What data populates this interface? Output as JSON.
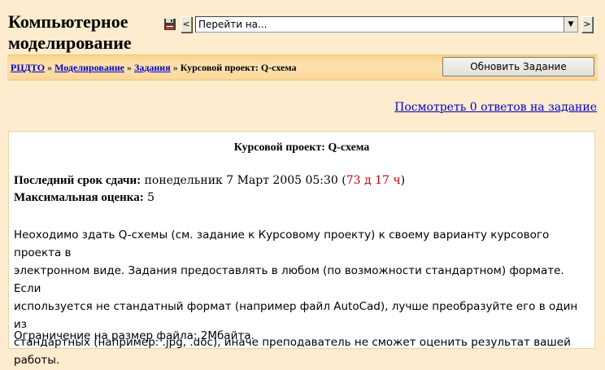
{
  "header": {
    "course_title_line1": "Компьютерное",
    "course_title_line2": "моделирование",
    "jump_select_value": "Перейти на...",
    "prev_arrow": "<",
    "next_arrow": ">",
    "dropdown_arrow": "▼"
  },
  "breadcrumb": {
    "items": [
      "РЦДТО",
      "Моделирование",
      "Задания"
    ],
    "separator": "»",
    "current": "Курсовой проект: Q-схема"
  },
  "toolbar": {
    "update_label": "Обновить Задание"
  },
  "view_link": "Посмотреть 0 ответов на задание",
  "assignment": {
    "title": "Курсовой проект: Q-схема",
    "due_label": "Последний срок сдачи:",
    "due_value": "понедельник 7 Март 2005 05:30",
    "time_remaining": "73 д 17 ч",
    "max_grade_label": "Максимальная оценка:",
    "max_grade_value": "5",
    "description_lines": [
      "Неоходимо здать Q-схемы (см. задание к Курсовому проекту) к своему варианту курсового проекта в",
      "электронном виде. Задания предоставлять в любом (по возможности стандартном) формате. Если",
      "используется не стандатный формат (например файл AutoCad), лучше преобразуйте его в один из",
      "стандартных (например: .jpg, .doc), иначе преподаватель не сможет оценить результат вашей",
      "работы."
    ],
    "file_limit": "Ограничение на размер файла: 2Мбайта."
  },
  "colors": {
    "page_bg": "#fdeccd",
    "link": "#0000cc",
    "remaining": "#cc0000"
  }
}
